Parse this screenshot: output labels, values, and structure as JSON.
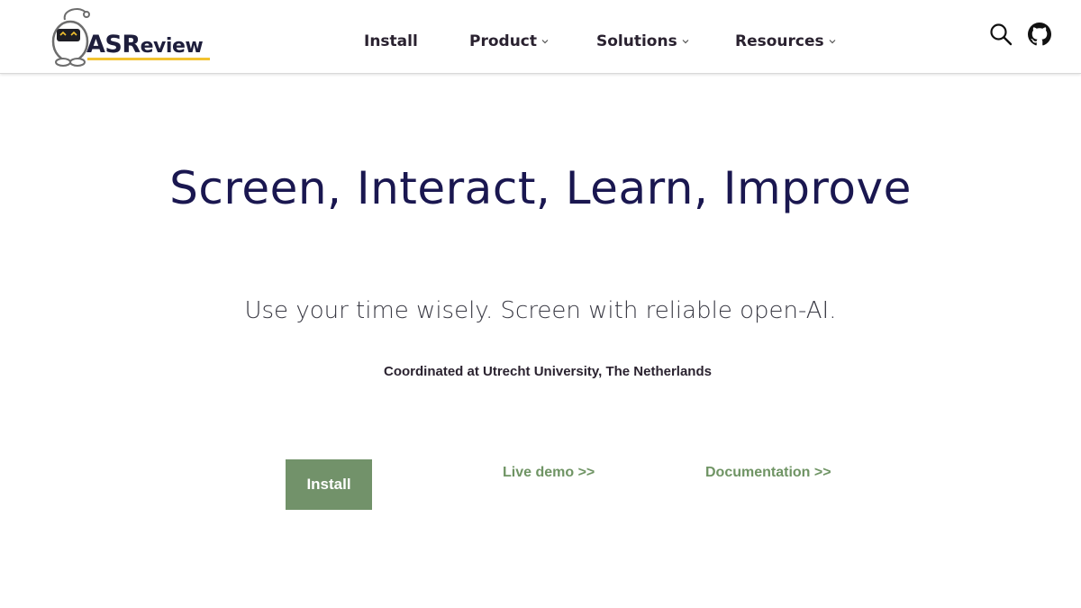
{
  "header": {
    "logo": {
      "text_main": "ASR",
      "text_small": "eview",
      "accent_color": "#f2c230"
    },
    "nav": [
      {
        "label": "Install",
        "has_dropdown": false
      },
      {
        "label": "Product",
        "has_dropdown": true
      },
      {
        "label": "Solutions",
        "has_dropdown": true
      },
      {
        "label": "Resources",
        "has_dropdown": true
      }
    ],
    "icons": [
      "search-icon",
      "github-icon"
    ]
  },
  "hero": {
    "title": "Screen, Interact, Learn, Improve",
    "subtitle": "Use your time wisely. Screen with reliable open-AI.",
    "coordinated": "Coordinated at Utrecht University, The Netherlands"
  },
  "cta": {
    "install_label": "Install",
    "demo_label": "Live demo >>",
    "docs_label": "Documentation >>"
  },
  "colors": {
    "title": "#1a1750",
    "button_bg": "#72926a",
    "link": "#6f9464"
  }
}
